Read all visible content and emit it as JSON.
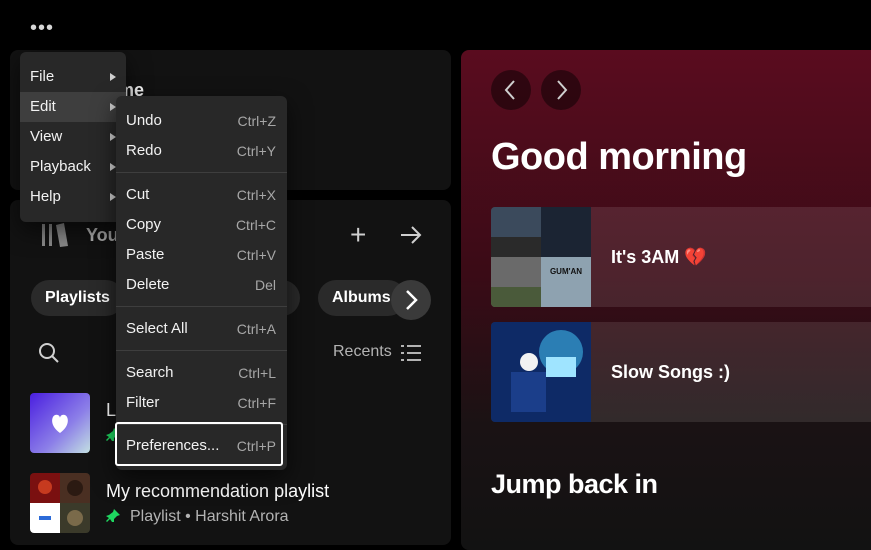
{
  "window": {
    "dots_icon": "more-horizontal-icon"
  },
  "home": {
    "title_fragment": "me"
  },
  "library": {
    "title_fragment": "You",
    "plus_label": "+",
    "chips": [
      "Playlists",
      "s",
      "Albums"
    ],
    "recents_label": "Recents",
    "items": [
      {
        "title_fragment": "L",
        "subtitle": ""
      },
      {
        "title": "My recommendation playlist",
        "subtitle": "Playlist • Harshit Arora"
      }
    ]
  },
  "main": {
    "greeting": "Good morning",
    "cards": [
      {
        "title": "It's 3AM 💔"
      },
      {
        "title": "Slow Songs :)"
      }
    ],
    "section_title": "Jump back in",
    "art_text": {
      "gum": "GUM'AN"
    }
  },
  "menu": {
    "items": [
      "File",
      "Edit",
      "View",
      "Playback",
      "Help"
    ]
  },
  "edit_menu": {
    "items": [
      {
        "label": "Undo",
        "shortcut": "Ctrl+Z"
      },
      {
        "label": "Redo",
        "shortcut": "Ctrl+Y"
      },
      {
        "label": "Cut",
        "shortcut": "Ctrl+X"
      },
      {
        "label": "Copy",
        "shortcut": "Ctrl+C"
      },
      {
        "label": "Paste",
        "shortcut": "Ctrl+V"
      },
      {
        "label": "Delete",
        "shortcut": "Del"
      },
      {
        "label": "Select All",
        "shortcut": "Ctrl+A"
      },
      {
        "label": "Search",
        "shortcut": "Ctrl+L"
      },
      {
        "label": "Filter",
        "shortcut": "Ctrl+F"
      },
      {
        "label": "Preferences...",
        "shortcut": "Ctrl+P"
      }
    ]
  },
  "colors": {
    "background": "#000000",
    "panel": "#121212",
    "menu": "#282828",
    "accent_green": "#1ed760",
    "main_gradient_top": "#5a0c1f"
  }
}
